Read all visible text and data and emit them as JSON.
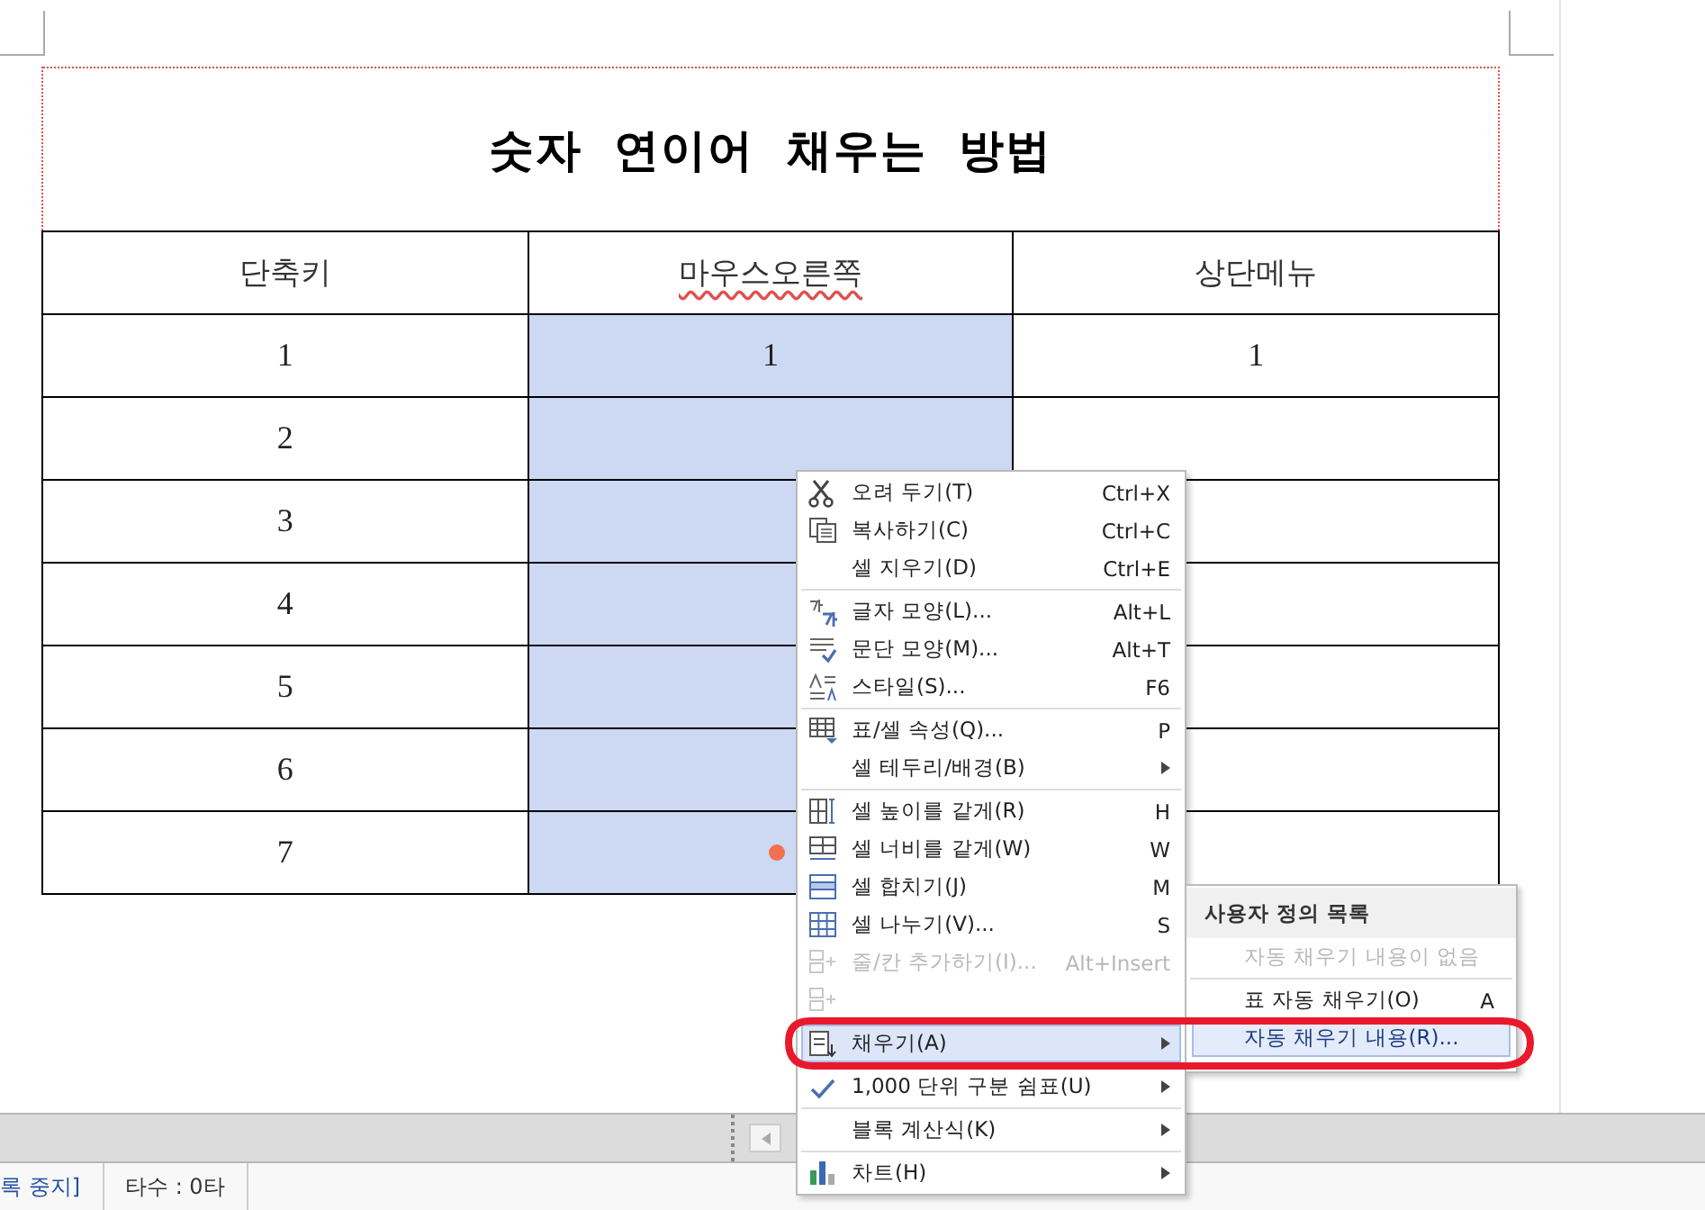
{
  "document": {
    "title": "숫자 연이어 채우는 방법",
    "table": {
      "columns": [
        {
          "label": "단축키",
          "misspelled": false
        },
        {
          "label": "마우스오른쪽",
          "misspelled": true
        },
        {
          "label": "상단메뉴",
          "misspelled": false
        }
      ],
      "rows": [
        {
          "cells": [
            {
              "text": "1",
              "selected": false
            },
            {
              "text": "1",
              "selected": true
            },
            {
              "text": "1",
              "selected": false
            }
          ]
        },
        {
          "cells": [
            {
              "text": "2",
              "selected": false
            },
            {
              "selected": true
            },
            {
              "selected": false
            }
          ]
        },
        {
          "cells": [
            {
              "text": "3",
              "selected": false
            },
            {
              "selected": true
            },
            {
              "selected": false
            }
          ]
        },
        {
          "cells": [
            {
              "text": "4",
              "selected": false
            },
            {
              "selected": true
            },
            {
              "selected": false
            }
          ]
        },
        {
          "cells": [
            {
              "text": "5",
              "selected": false
            },
            {
              "selected": true
            },
            {
              "selected": false
            }
          ]
        },
        {
          "cells": [
            {
              "text": "6",
              "selected": false
            },
            {
              "selected": true
            },
            {
              "selected": false
            }
          ]
        },
        {
          "cells": [
            {
              "text": "7",
              "selected": false
            },
            {
              "selected": true
            },
            {
              "selected": false
            }
          ]
        }
      ]
    }
  },
  "context_menu": {
    "groups": [
      [
        {
          "label": "오려 두기(T)",
          "shortcut": "Ctrl+X",
          "disabled": false,
          "submenu": false,
          "selected": false
        },
        {
          "label": "복사하기(C)",
          "shortcut": "Ctrl+C",
          "disabled": false,
          "submenu": false,
          "selected": false
        },
        {
          "label": "셀 지우기(D)",
          "shortcut": "Ctrl+E",
          "disabled": false,
          "submenu": false,
          "selected": false
        }
      ],
      [
        {
          "label": "글자 모양(L)...",
          "shortcut": "Alt+L",
          "disabled": false,
          "submenu": false,
          "selected": false
        },
        {
          "label": "문단 모양(M)...",
          "shortcut": "Alt+T",
          "disabled": false,
          "submenu": false,
          "selected": false
        },
        {
          "label": "스타일(S)...",
          "shortcut": "F6",
          "disabled": false,
          "submenu": false,
          "selected": false
        }
      ],
      [
        {
          "label": "표/셀 속성(Q)...",
          "shortcut": "P",
          "disabled": false,
          "submenu": false,
          "selected": false
        },
        {
          "label": "셀 테두리/배경(B)",
          "disabled": false,
          "submenu": true,
          "selected": false
        }
      ],
      [
        {
          "label": "셀 높이를 같게(R)",
          "shortcut": "H",
          "disabled": false,
          "submenu": false,
          "selected": false
        },
        {
          "label": "셀 너비를 같게(W)",
          "shortcut": "W",
          "disabled": false,
          "submenu": false,
          "selected": false
        },
        {
          "label": "셀 합치기(J)",
          "shortcut": "M",
          "disabled": false,
          "submenu": false,
          "selected": false
        },
        {
          "label": "셀 나누기(V)...",
          "shortcut": "S",
          "disabled": false,
          "submenu": false,
          "selected": false
        },
        {
          "label": "줄/칸 추가하기(I)...",
          "shortcut": "Alt+Insert",
          "disabled": true,
          "submenu": false,
          "selected": false
        },
        {
          "disabled": true,
          "submenu": false,
          "selected": false
        }
      ],
      [
        {
          "label": "채우기(A)",
          "disabled": false,
          "submenu": true,
          "selected": true
        }
      ],
      [
        {
          "label": "1,000 단위 구분 쉼표(U)",
          "disabled": false,
          "submenu": true,
          "selected": false
        }
      ],
      [
        {
          "label": "블록 계산식(K)",
          "disabled": false,
          "submenu": true,
          "selected": false
        }
      ],
      [
        {
          "label": "차트(H)",
          "disabled": false,
          "submenu": true,
          "selected": false
        }
      ]
    ]
  },
  "submenu": {
    "header": "사용자 정의 목록",
    "items": [
      {
        "label": "자동 채우기 내용이 없음",
        "disabled": true,
        "selected": false
      },
      {
        "label": "표 자동 채우기(O)",
        "shortcut": "A",
        "disabled": false,
        "selected": false
      },
      {
        "label": "자동 채우기 내용(R)...",
        "disabled": false,
        "selected": true
      }
    ]
  },
  "status_bar": {
    "items": [
      "록 중지]",
      "타수 : 0타"
    ]
  }
}
